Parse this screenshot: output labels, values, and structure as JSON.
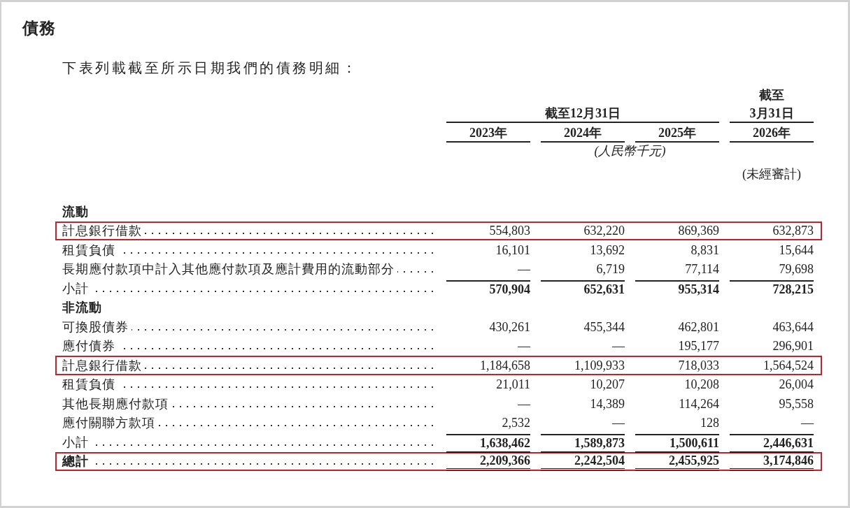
{
  "heading": "債務",
  "intro": "下表列載截至所示日期我們的債務明細：",
  "header": {
    "period_group": "截至12月31日",
    "last_period": [
      "截至",
      "3月31日"
    ],
    "years": [
      "2023年",
      "2024年",
      "2025年",
      "2026年"
    ],
    "unit": "(人民幣千元)",
    "unaudited": "(未經審計)"
  },
  "rows": [
    {
      "kind": "section",
      "label": "流動",
      "highlighted": false
    },
    {
      "kind": "item",
      "label": "計息銀行借款",
      "values": [
        "554,803",
        "632,220",
        "869,369",
        "632,873"
      ],
      "highlighted": true
    },
    {
      "kind": "item",
      "label": "租賃負債",
      "values": [
        "16,101",
        "13,692",
        "8,831",
        "15,644"
      ],
      "highlighted": false
    },
    {
      "kind": "item",
      "label": "長期應付款項中計入其他應付款項及應計費用的流動部分",
      "values": [
        "—",
        "6,719",
        "77,114",
        "79,698"
      ],
      "highlighted": false
    },
    {
      "kind": "subtotal",
      "label": "小計",
      "values": [
        "570,904",
        "652,631",
        "955,314",
        "728,215"
      ],
      "highlighted": false
    },
    {
      "kind": "section",
      "label": "非流動",
      "highlighted": false
    },
    {
      "kind": "item",
      "label": "可換股債券",
      "values": [
        "430,261",
        "455,344",
        "462,801",
        "463,644"
      ],
      "highlighted": false
    },
    {
      "kind": "item",
      "label": "應付債券",
      "values": [
        "—",
        "—",
        "195,177",
        "296,901"
      ],
      "highlighted": false
    },
    {
      "kind": "item",
      "label": "計息銀行借款",
      "values": [
        "1,184,658",
        "1,109,933",
        "718,033",
        "1,564,524"
      ],
      "highlighted": true
    },
    {
      "kind": "item",
      "label": "租賃負債",
      "values": [
        "21,011",
        "10,207",
        "10,208",
        "26,004"
      ],
      "highlighted": false
    },
    {
      "kind": "item",
      "label": "其他長期應付款項",
      "values": [
        "—",
        "14,389",
        "114,264",
        "95,558"
      ],
      "highlighted": false
    },
    {
      "kind": "item",
      "label": "應付關聯方款項",
      "values": [
        "2,532",
        "—",
        "128",
        "—"
      ],
      "highlighted": false
    },
    {
      "kind": "subtotal",
      "label": "小計",
      "values": [
        "1,638,462",
        "1,589,873",
        "1,500,611",
        "2,446,631"
      ],
      "highlighted": false
    },
    {
      "kind": "total",
      "label": "總計",
      "values": [
        "2,209,366",
        "2,242,504",
        "2,455,925",
        "3,174,846"
      ],
      "highlighted": true
    }
  ]
}
